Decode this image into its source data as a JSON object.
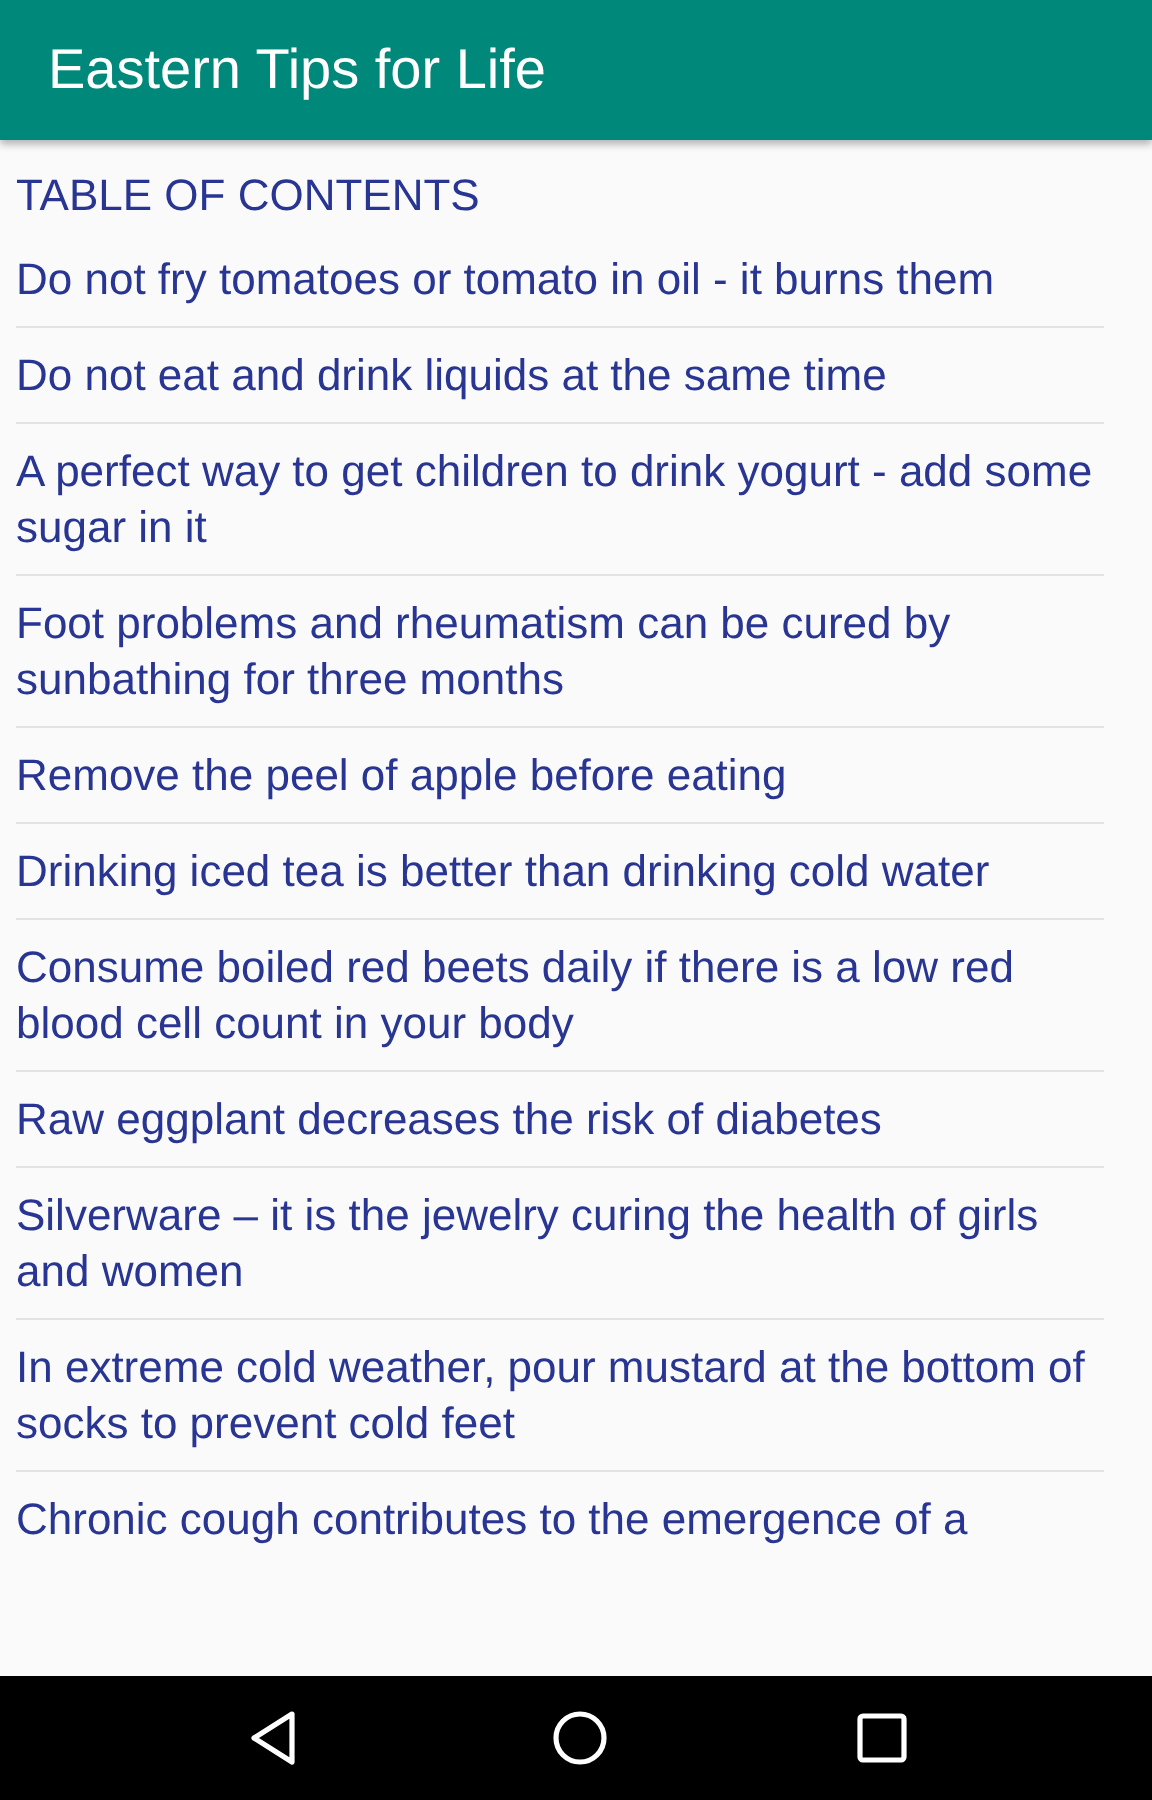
{
  "app_bar": {
    "title": "Eastern Tips for Life"
  },
  "toc_heading": "TABLE OF CONTENTS",
  "items": [
    "Do not fry tomatoes or tomato in oil - it burns them",
    "Do not eat and drink liquids at the same time",
    "A perfect way to get children to drink yogurt - add some sugar in it",
    "Foot problems and rheumatism can be cured by sunbathing for three months",
    "Remove the peel of apple before eating",
    "Drinking iced tea is better than drinking cold water",
    "Consume boiled red beets daily if there is a low red blood cell count in your body",
    "Raw eggplant decreases the risk of diabetes",
    "Silverware – it is the jewelry curing the health of girls and women",
    "In extreme cold weather, pour mustard at the bottom of socks to prevent cold feet",
    "Chronic cough contributes to the emergence of a"
  ],
  "nav_bar": {
    "buttons": [
      {
        "kind": "back"
      },
      {
        "kind": "home"
      },
      {
        "kind": "recents"
      }
    ]
  }
}
